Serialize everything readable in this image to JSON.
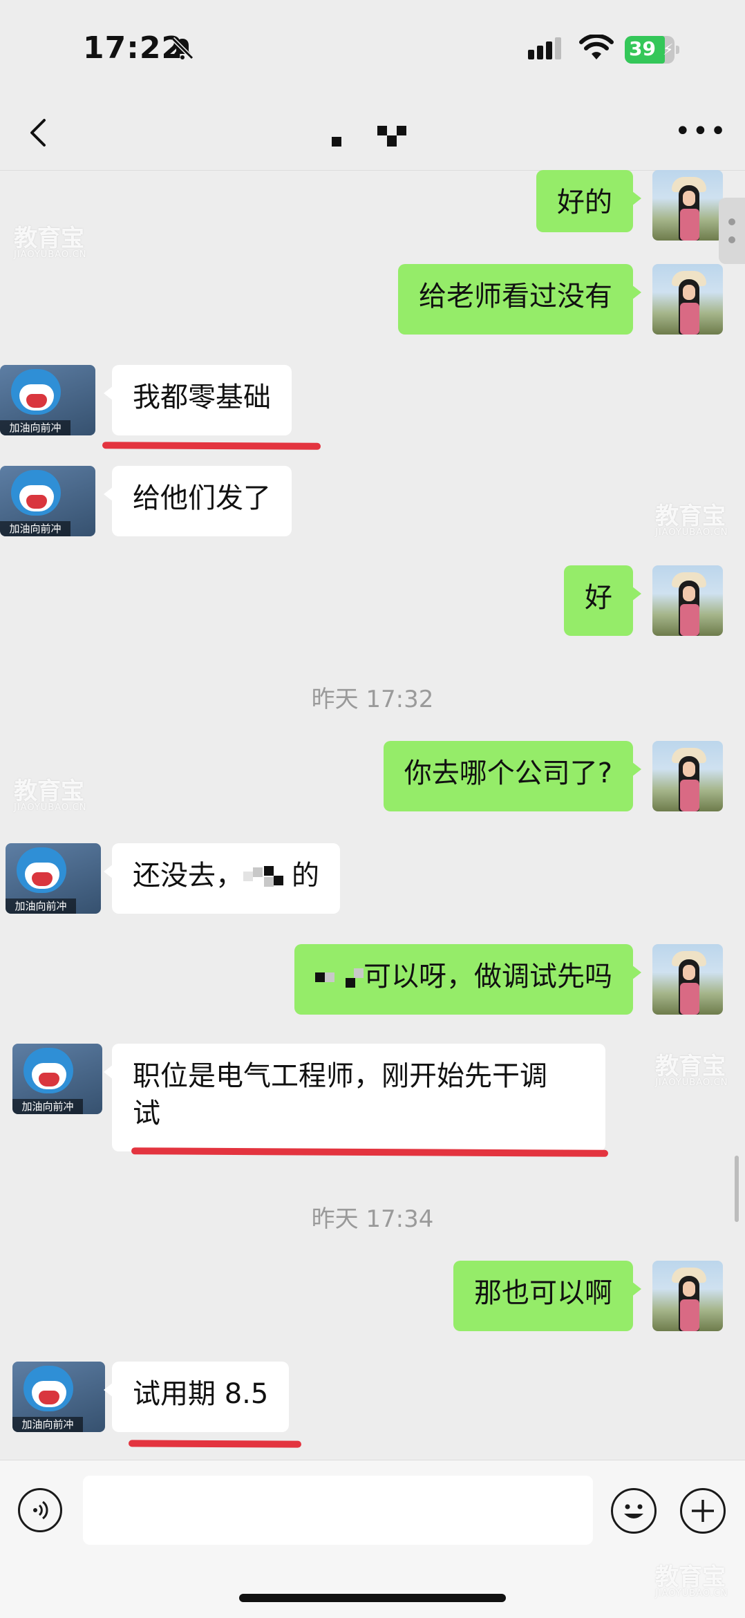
{
  "status_bar": {
    "time": "17:22",
    "battery": "39"
  },
  "chat": {
    "timestamps": [
      "昨天 17:32",
      "昨天 17:34"
    ],
    "avatar_caption": "加油向前冲",
    "messages": [
      {
        "side": "me",
        "text": "好的"
      },
      {
        "side": "me",
        "text": "给老师看过没有"
      },
      {
        "side": "them",
        "text": "我都零基础",
        "underlined": true
      },
      {
        "side": "them",
        "text": "给他们发了"
      },
      {
        "side": "me",
        "text": "好"
      },
      {
        "side": "me",
        "text": "你去哪个公司了?"
      },
      {
        "side": "them",
        "text_before": "还没去，",
        "text_after": "的",
        "redacted": true
      },
      {
        "side": "me",
        "text_after": "可以呀，做调试先吗",
        "redacted": true
      },
      {
        "side": "them",
        "line1": "职位是电气工程师，刚开始先干调",
        "line2": "试",
        "underlined": true
      },
      {
        "side": "me",
        "text": "那也可以啊"
      },
      {
        "side": "them",
        "text": "试用期 8.5",
        "underlined": true
      }
    ]
  },
  "watermark": {
    "main": "教育宝",
    "sub": "JIAOYUBAO.CN"
  },
  "colors": {
    "my_bubble": "#95ec69",
    "their_bubble": "#ffffff",
    "background": "#ededed",
    "underline": "#e3343f"
  }
}
